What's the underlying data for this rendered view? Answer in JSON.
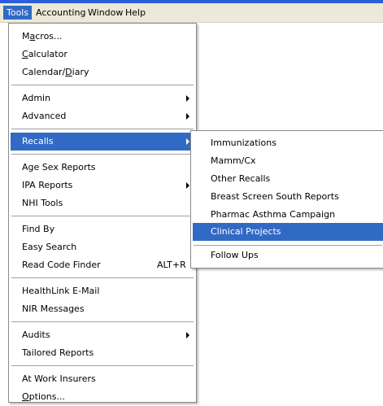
{
  "menubar": {
    "items": [
      {
        "label": "Tools"
      },
      {
        "label": "Accounting"
      },
      {
        "label": "Window"
      },
      {
        "label": "Help"
      }
    ]
  },
  "tools_menu": {
    "items": [
      {
        "pre": "M",
        "ul": "a",
        "post": "cros..."
      },
      {
        "pre": "",
        "ul": "C",
        "post": "alculator"
      },
      {
        "pre": "Calendar/",
        "ul": "D",
        "post": "iary"
      },
      {
        "label": "Admin"
      },
      {
        "label": "Advanced"
      },
      {
        "label": "Recalls"
      },
      {
        "label": "Age Sex Reports"
      },
      {
        "label": "IPA Reports"
      },
      {
        "label": "NHI Tools"
      },
      {
        "label": "Find By"
      },
      {
        "label": "Easy Search"
      },
      {
        "label": "Read Code Finder",
        "shortcut": "ALT+R"
      },
      {
        "label": "HealthLink E-Mail"
      },
      {
        "label": "NIR Messages"
      },
      {
        "label": "Audits"
      },
      {
        "label": "Tailored Reports"
      },
      {
        "label": "At Work Insurers"
      },
      {
        "pre": "",
        "ul": "O",
        "post": "ptions..."
      }
    ]
  },
  "recalls_submenu": {
    "items": [
      {
        "label": "Immunizations"
      },
      {
        "label": "Mamm/Cx"
      },
      {
        "label": "Other Recalls"
      },
      {
        "label": "Breast Screen South Reports"
      },
      {
        "label": "Pharmac Asthma Campaign"
      },
      {
        "label": "Clinical Projects"
      },
      {
        "label": "Follow Ups"
      }
    ]
  }
}
